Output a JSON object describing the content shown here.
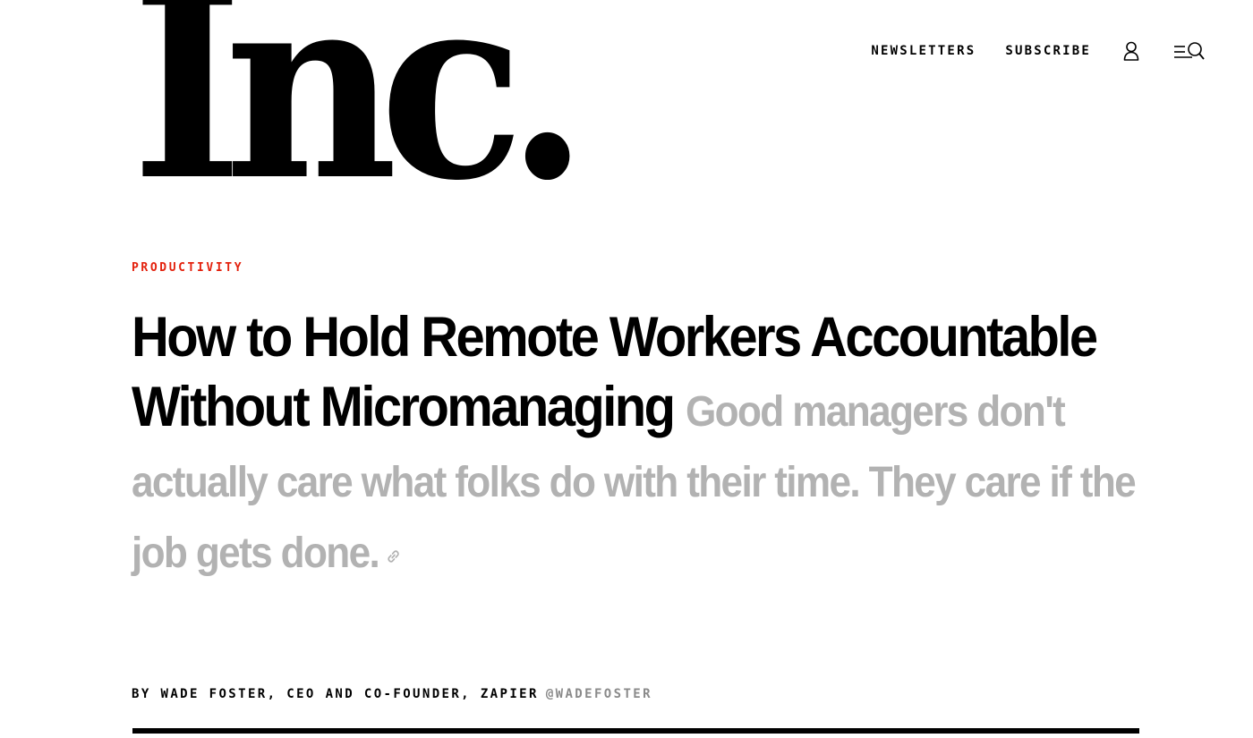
{
  "header": {
    "logo_text": "Inc.",
    "nav": {
      "newsletters_label": "NEWSLETTERS",
      "subscribe_label": "SUBSCRIBE"
    },
    "icons": [
      "user-icon",
      "menu-search-icon"
    ]
  },
  "article": {
    "category": "PRODUCTIVITY",
    "headline": "How to Hold Remote Workers Accountable Without Micromanaging",
    "dek": "Good managers don't actually care what folks do with their time. They care if the job gets done.",
    "byline": "BY WADE FOSTER, CEO AND CO-FOUNDER, ZAPIER",
    "author_handle": "@WADEFOSTER"
  },
  "colors": {
    "category_red": "#e3210d",
    "dek_gray": "#b2b2b2",
    "handle_gray": "#8a8a8a"
  }
}
